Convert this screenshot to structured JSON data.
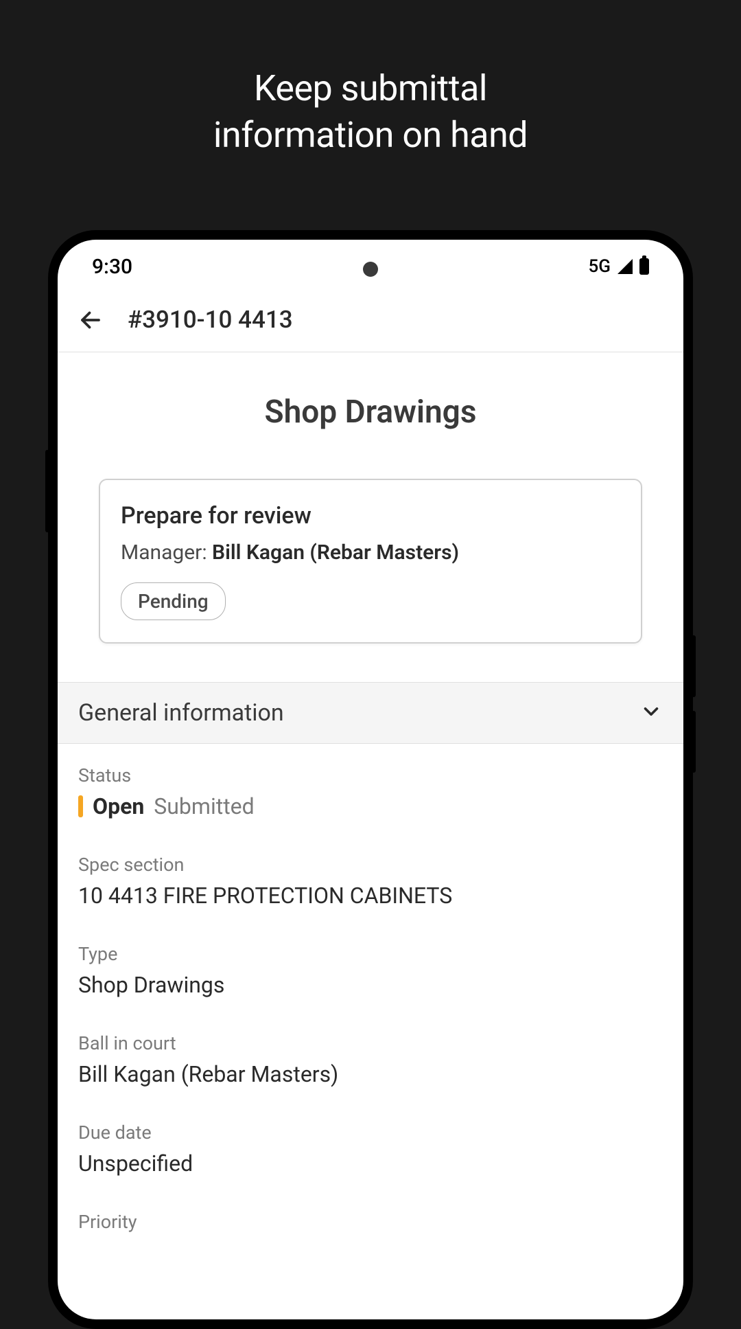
{
  "promo": {
    "line1": "Keep submittal",
    "line2": "information on hand"
  },
  "statusBar": {
    "time": "9:30",
    "network": "5G"
  },
  "header": {
    "title": "#3910-10 4413"
  },
  "pageTitle": "Shop Drawings",
  "reviewCard": {
    "title": "Prepare for review",
    "managerLabel": "Manager: ",
    "managerValue": "Bill Kagan (Rebar Masters)",
    "pill": "Pending"
  },
  "section": {
    "title": "General information"
  },
  "info": {
    "statusLabel": "Status",
    "statusOpen": "Open",
    "statusSub": "Submitted",
    "specLabel": "Spec section",
    "specValue": "10 4413 FIRE PROTECTION CABINETS",
    "typeLabel": "Type",
    "typeValue": "Shop Drawings",
    "ballLabel": "Ball in court",
    "ballValue": "Bill Kagan (Rebar Masters)",
    "dueLabel": "Due date",
    "dueValue": "Unspecified",
    "priorityLabel": "Priority"
  }
}
